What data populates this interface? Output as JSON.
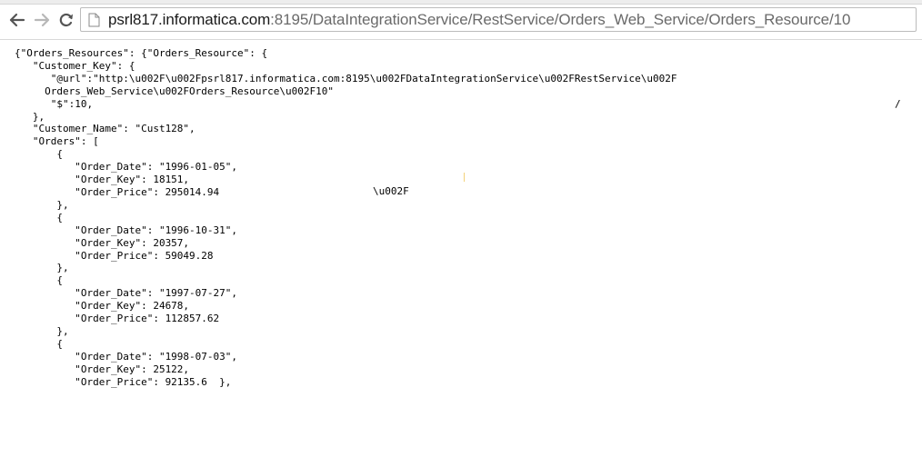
{
  "browser": {
    "url_host": "psrl817.informatica.com",
    "url_rest": ":8195/DataIntegrationService/RestService/Orders_Web_Service/Orders_Resource/10",
    "icons": {
      "back": "arrow-left-icon",
      "forward": "arrow-right-icon",
      "reload": "reload-icon",
      "page": "page-icon"
    }
  },
  "content": {
    "lines": [
      "{\"Orders_Resources\": {\"Orders_Resource\": {",
      "   \"Customer_Key\": {",
      "      \"@url\":\"http:\\u002F\\u002Fpsrl817.informatica.com:8195\\u002FDataIntegrationService\\u002FRestService\\u002F",
      "     Orders_Web_Service\\u002FOrders_Resource\\u002F10\"",
      "      \"$\":10,",
      "   },",
      "   \"Customer_Name\": \"Cust128\",",
      "   \"Orders\": [",
      "       {",
      "          \"Order_Date\": \"1996-01-05\",",
      "          \"Order_Key\": 18151,",
      "          \"Order_Price\": 295014.94",
      "       },",
      "       {",
      "          \"Order_Date\": \"1996-10-31\",",
      "          \"Order_Key\": 20357,",
      "          \"Order_Price\": 59049.28",
      "       },",
      "       {",
      "          \"Order_Date\": \"1997-07-27\",",
      "          \"Order_Key\": 24678,",
      "          \"Order_Price\": 112857.62",
      "       },",
      "       {",
      "          \"Order_Date\": \"1998-07-03\",",
      "          \"Order_Key\": 25122,",
      "          \"Order_Price\": 92135.6  },"
    ],
    "stray_slash": "/",
    "stray_escape": "\\u002F"
  }
}
